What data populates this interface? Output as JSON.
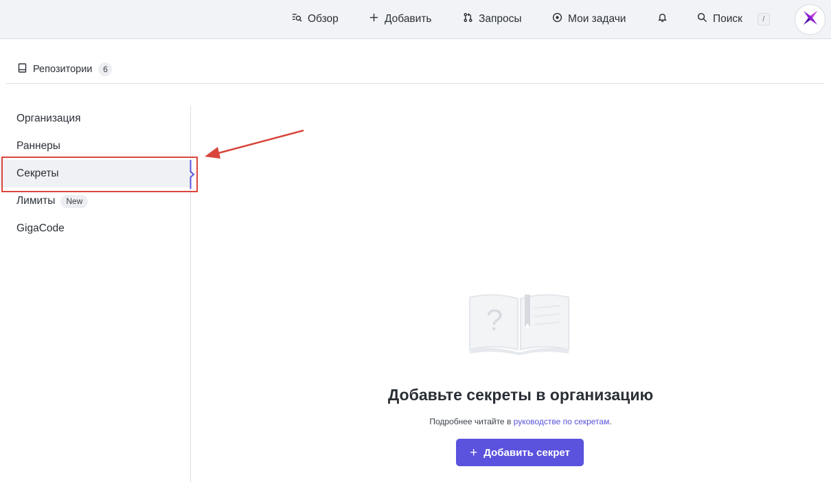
{
  "header": {
    "nav": [
      {
        "label": "Обзор",
        "icon": "overview-icon"
      },
      {
        "label": "Добавить",
        "icon": "plus-icon"
      },
      {
        "label": "Запросы",
        "icon": "pull-request-icon"
      },
      {
        "label": "Мои задачи",
        "icon": "tasks-icon"
      }
    ],
    "notifications_icon": "bell-icon",
    "search": {
      "label": "Поиск",
      "shortcut": "/"
    },
    "avatar_icon": "logo-avatar-icon"
  },
  "repo_tab": {
    "label": "Репозитории",
    "count": "6"
  },
  "sidebar": {
    "items": [
      {
        "label": "Организация"
      },
      {
        "label": "Раннеры"
      },
      {
        "label": "Секреты",
        "active": true
      },
      {
        "label": "Лимиты",
        "badge": "New"
      },
      {
        "label": "GigaCode"
      }
    ]
  },
  "empty_state": {
    "title": "Добавьте секреты в организацию",
    "desc_prefix": "Подробнее читайте в ",
    "desc_link": "руководстве по секретам",
    "desc_suffix": ".",
    "button_label": "Добавить секрет"
  },
  "colors": {
    "accent": "#5b52de",
    "link": "#5551d8",
    "annotation": "#d9453c"
  }
}
